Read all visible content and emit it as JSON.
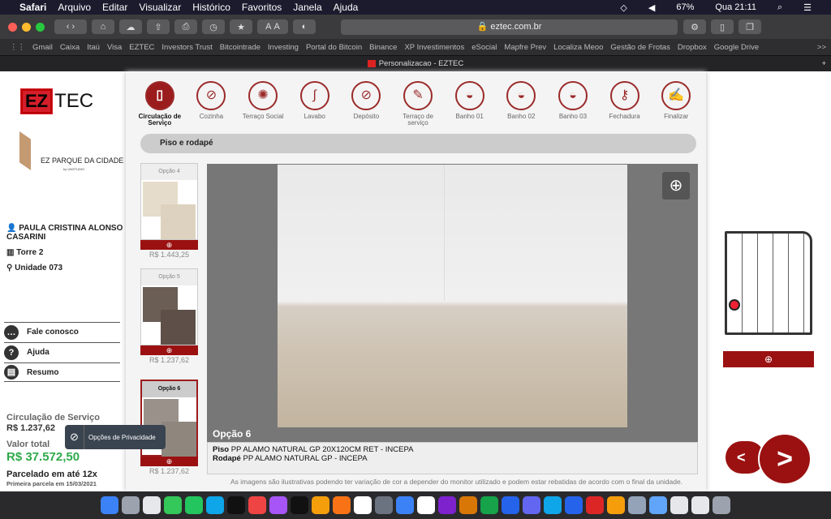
{
  "menubar": {
    "apple": "",
    "items": [
      "Safari",
      "Arquivo",
      "Editar",
      "Visualizar",
      "Histórico",
      "Favoritos",
      "Janela",
      "Ajuda"
    ],
    "battery": "67%",
    "clock": "Qua 21:11"
  },
  "browser": {
    "url": "eztec.com.br",
    "font_small": "A",
    "font_large": "A",
    "bookmarks": [
      "Gmail",
      "Caixa",
      "Itaú",
      "Visa",
      "EZTEC",
      "Investors Trust",
      "Bitcointrade",
      "Investing",
      "Portal do Bitcoin",
      "Binance",
      "XP Investimentos",
      "eSocial",
      "Mapfre Prev",
      "Localiza Meoo",
      "Gestão de Frotas",
      "Dropbox",
      "Google Drive"
    ],
    "more": ">>",
    "tab_title": "Personalizacao - EZTEC",
    "new_tab": "+"
  },
  "sidebar": {
    "logo_ez": "EZ",
    "logo_tec": "TEC",
    "project": "EZ PARQUE DA CIDADE",
    "project_sub": "by UNSTUDIO",
    "client": "PAULA CRISTINA ALONSO CASARINI",
    "tower": "Torre 2",
    "unit": "Unidade 073",
    "menu": [
      {
        "label": "Fale conosco",
        "icon": "chat-icon"
      },
      {
        "label": "Ajuda",
        "icon": "help-icon"
      },
      {
        "label": "Resumo",
        "icon": "document-icon"
      }
    ],
    "section_label": "Circulação de Serviço",
    "section_price": "R$ 1.237,62",
    "total_label": "Valor total",
    "total": "R$ 37.572,50",
    "installments": "Parcelado em até 12x",
    "first_installment": "Primeira parcela em 15/03/2021",
    "privacy": "Opções de Privacidade"
  },
  "nav": [
    {
      "label": "Circulação de Serviço",
      "icon": "door-icon",
      "active": true
    },
    {
      "label": "Cozinha",
      "icon": "cutlery-icon"
    },
    {
      "label": "Terraço Social",
      "icon": "sun-icon"
    },
    {
      "label": "Lavabo",
      "icon": "faucet-icon"
    },
    {
      "label": "Depósito",
      "icon": "cutlery-icon"
    },
    {
      "label": "Terraço de serviço",
      "icon": "clothespin-icon"
    },
    {
      "label": "Banho 01",
      "icon": "shower-icon"
    },
    {
      "label": "Banho 02",
      "icon": "shower-icon"
    },
    {
      "label": "Banho 03",
      "icon": "shower-icon"
    },
    {
      "label": "Fechadura",
      "icon": "key-icon"
    },
    {
      "label": "Finalizar",
      "icon": "checklist-icon"
    }
  ],
  "subheader": "Piso e rodapé",
  "options": [
    {
      "label": "Opção 4",
      "price": "R$ 1.443,25",
      "color1": "#e6dccb",
      "color2": "#ddd2bf"
    },
    {
      "label": "Opção 5",
      "price": "R$ 1.237,62",
      "color1": "#6b5e55",
      "color2": "#5e5048"
    },
    {
      "label": "Opção 6",
      "price": "R$ 1.237,62",
      "color1": "#9a928a",
      "color2": "#8f877e",
      "selected": true
    }
  ],
  "viewer": {
    "caption": "Opção 6",
    "floor_label": "Piso",
    "floor_value": "PP ALAMO NATURAL GP 20X120CM RET - INCEPA",
    "baseboard_label": "Rodapé",
    "baseboard_value": "PP ALAMO NATURAL GP - INCEPA",
    "disclaimer": "As imagens são ilustrativas podendo ter variação de cor a depender do monitor utilizado e podem estar rebatidas de acordo com o final da unidade."
  },
  "pager": {
    "prev": "<",
    "next": ">"
  },
  "colors": {
    "brand": "#9b1c1c",
    "total": "#2eaa4a"
  },
  "dock": [
    "#3b82f6",
    "#9ca3af",
    "#e5e7eb",
    "#34c759",
    "#22c55e",
    "#0ea5e9",
    "#111",
    "#ef4444",
    "#a855f7",
    "#111",
    "#f59e0b",
    "#f97316",
    "#fff",
    "#6b7280",
    "#3b82f6",
    "#ffffff",
    "#7e22ce",
    "#d97706",
    "#16a34a",
    "#2563eb",
    "#6366f1",
    "#0ea5e9",
    "#2563eb",
    "#dc2626",
    "#f59e0b",
    "#94a3b8",
    "#60a5fa",
    "#e5e7eb",
    "#e5e7eb",
    "#9ca3af"
  ]
}
